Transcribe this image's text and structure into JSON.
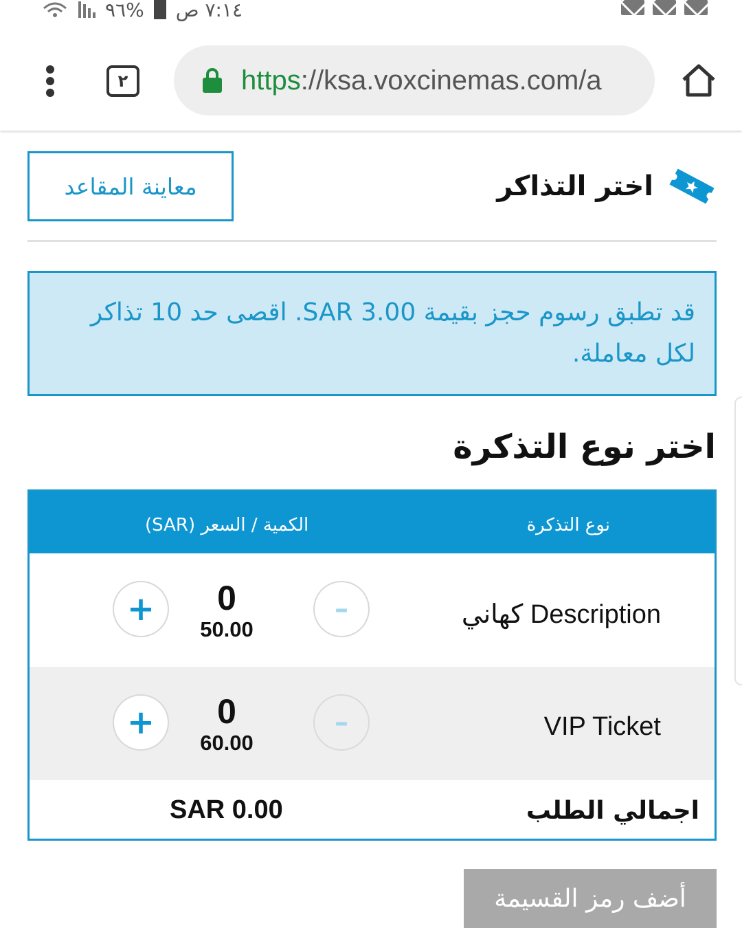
{
  "status_bar": {
    "time": "٧:١٤ ص",
    "battery": "%٩٦"
  },
  "browser": {
    "tab_count": "٢",
    "url_scheme": "https",
    "url_rest": "://ksa.voxcinemas.com/a"
  },
  "header": {
    "title": "اختر التذاكر",
    "preview_seats_label": "معاينة المقاعد"
  },
  "info": {
    "text": "قد تطبق رسوم حجز بقيمة SAR 3.00. اقصى حد 10 تذاكر لكل معاملة."
  },
  "ticket_section": {
    "title": "اختر نوع التذكرة"
  },
  "table": {
    "col_type": "نوع التذكرة",
    "col_qty_price": "الكمية / السعر (SAR)",
    "rows": [
      {
        "name": "كهاني Description",
        "qty": "0",
        "price": "50.00"
      },
      {
        "name": "VIP Ticket",
        "qty": "0",
        "price": "60.00"
      }
    ],
    "plus_label": "+",
    "minus_label": "–",
    "total_label": "اجمالي الطلب",
    "total_value": "SAR 0.00"
  },
  "promo": {
    "label": "أضف رمز القسيمة"
  },
  "colors": {
    "accent": "#0d96d2",
    "info_bg": "#cde9f6",
    "disabled_button": "#a9a9a9",
    "secure_green": "#1e8e3e"
  }
}
